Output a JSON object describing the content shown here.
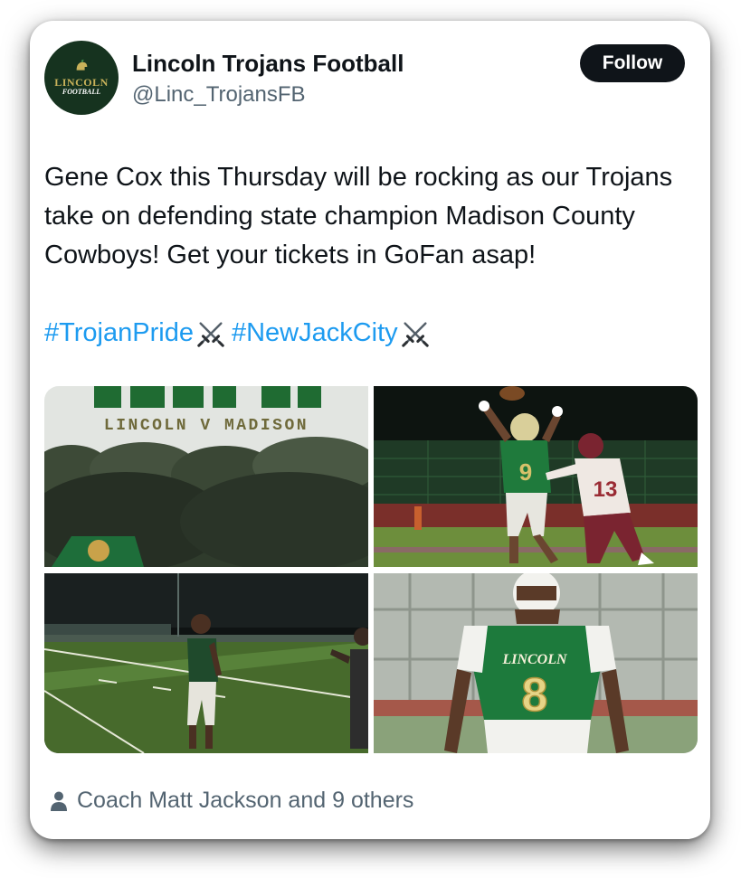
{
  "author": {
    "name": "Lincoln Trojans Football",
    "handle": "@Linc_TrojansFB",
    "avatar_logo_word": "LINCOLN",
    "avatar_logo_sub": "FOOTBALL"
  },
  "follow_label": "Follow",
  "tweet": {
    "text": "Gene Cox this Thursday will be rocking as our Trojans take on defending state champion Madison County Cowboys! Get your tickets in GoFan asap!",
    "hashtags": [
      "#TrojanPride",
      "#NewJackCity"
    ],
    "hashtag_emoji": "crossed-swords-icon"
  },
  "photos": {
    "photo1_caption": "LINCOLN V MADISON",
    "photo4_jersey_word": "LINCOLN",
    "photo4_jersey_number": "8",
    "photo2_jersey_numbers": [
      "9",
      "13"
    ]
  },
  "liked_by": {
    "icon": "person-icon",
    "text": "Coach Matt Jackson and 9 others"
  },
  "colors": {
    "text_primary": "#0f1419",
    "text_secondary": "#536471",
    "link": "#1d9bf0",
    "follow_bg": "#0f1419",
    "avatar_bg": "#16331f",
    "team_green": "#1d7a3c",
    "team_gold": "#c9b25a"
  }
}
